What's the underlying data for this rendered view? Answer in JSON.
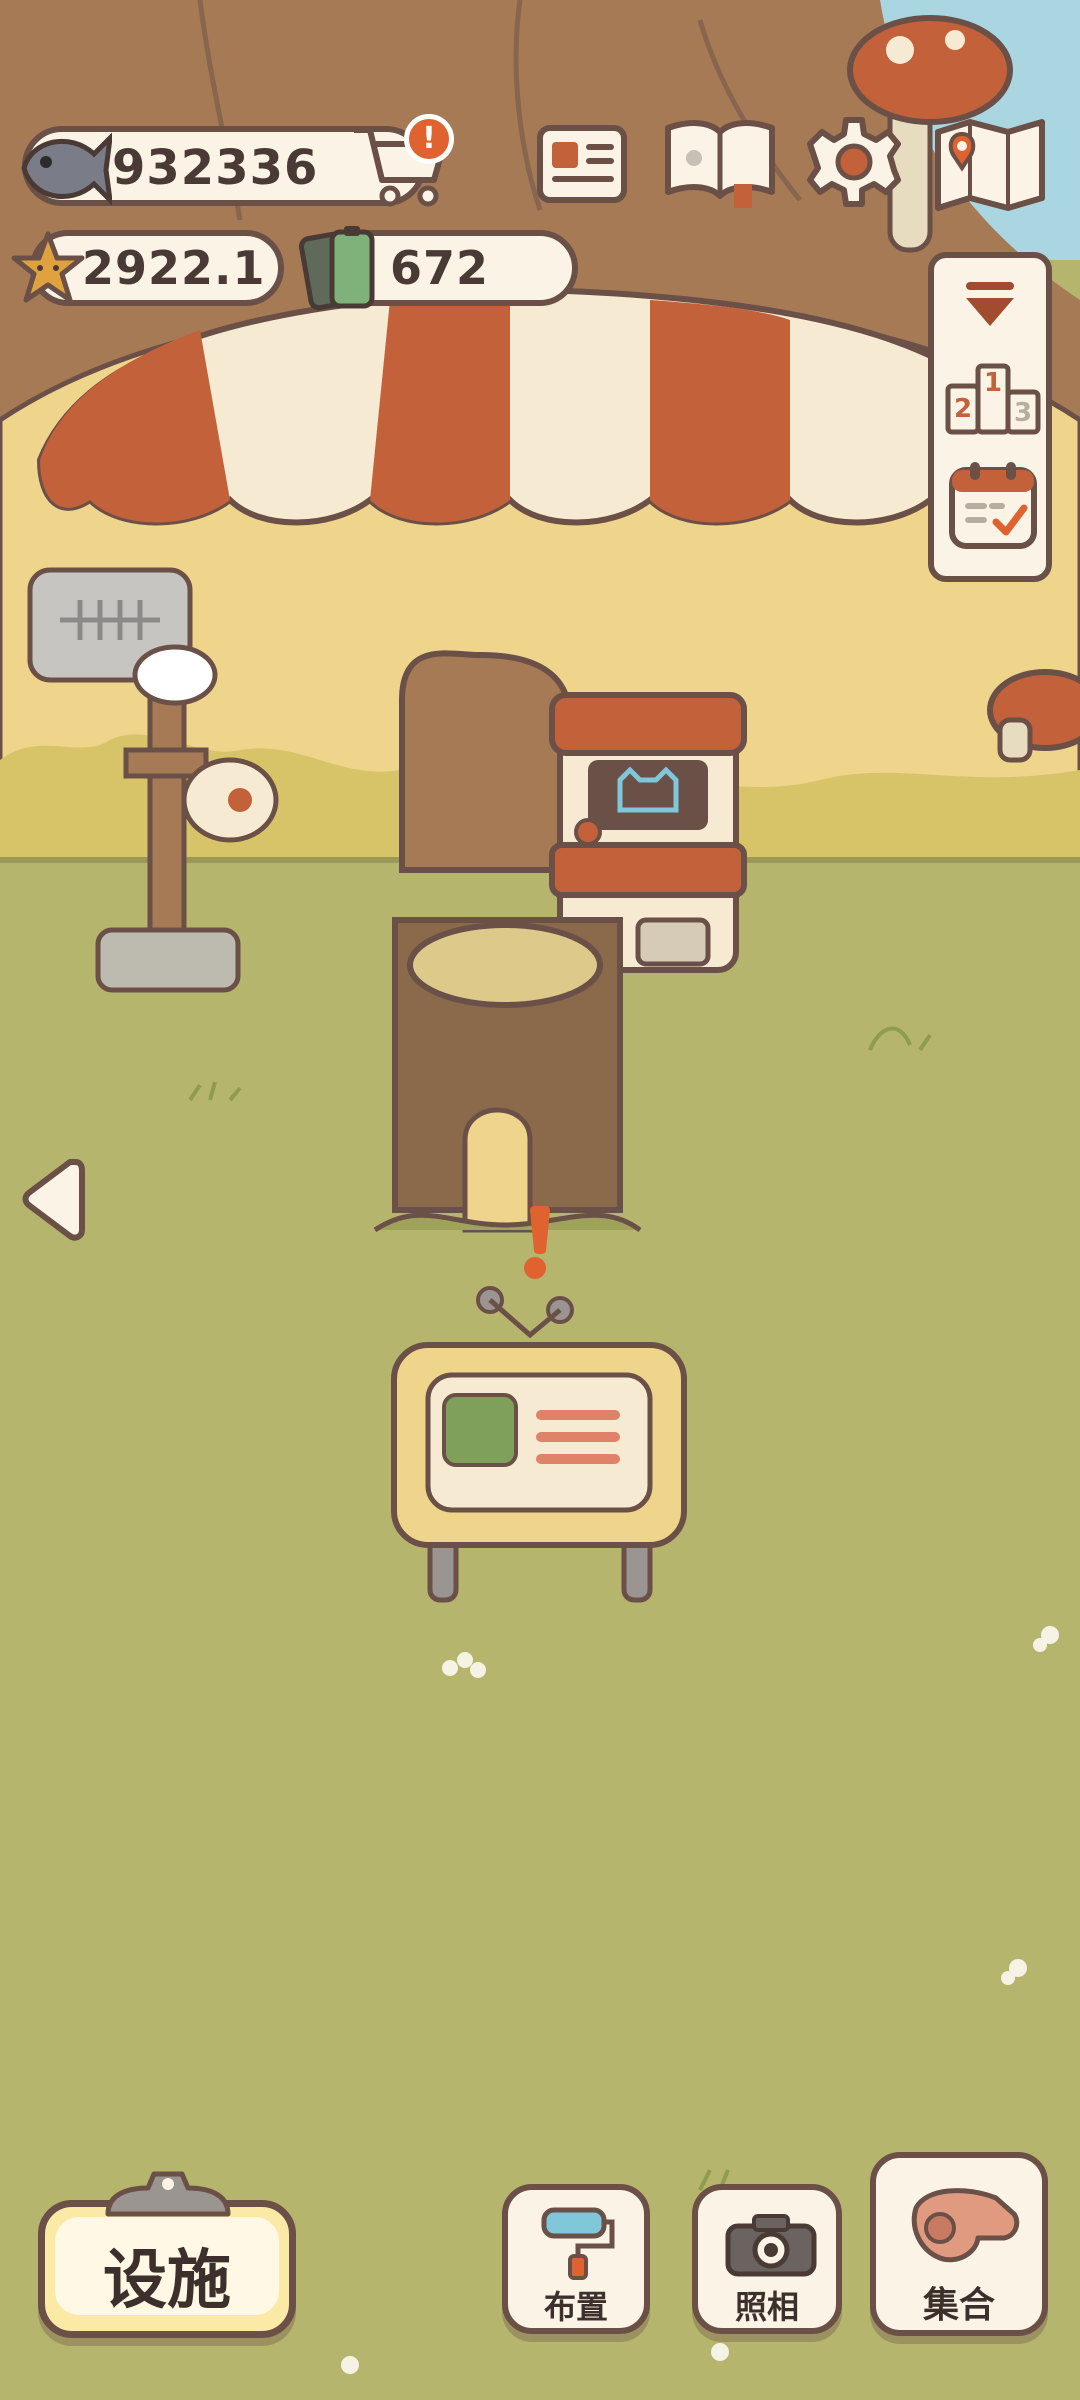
{
  "resources": {
    "fish": "932336",
    "stars": "2922.1",
    "battery": "672"
  },
  "notifications": {
    "shop_alert": "!"
  },
  "side_panel": {
    "rank_digits": [
      "2",
      "1",
      "3"
    ]
  },
  "bottom_bar": {
    "facility_label": "设施",
    "layout_label": "布置",
    "photo_label": "照相",
    "gather_label": "集合"
  },
  "icons": {
    "fish": "fish-icon",
    "shop": "shopping-cart-icon",
    "star": "star-icon",
    "battery": "battery-icon",
    "newspaper": "newspaper-icon",
    "album": "paw-book-icon",
    "settings": "gear-icon",
    "map": "map-icon",
    "collapse": "collapse-arrow-icon",
    "ranking": "podium-icon",
    "calendar": "calendar-icon",
    "back": "left-arrow-icon",
    "layout": "paint-roller-icon",
    "photo": "camera-icon",
    "gather": "whistle-icon"
  },
  "colors": {
    "grass": "#b5b56e",
    "wall": "#efd48b",
    "awning_red": "#c2613a",
    "awning_cream": "#f6ead2",
    "outline": "#6a5047",
    "panel_bg": "#fbf4e6",
    "alert": "#e0622f"
  }
}
